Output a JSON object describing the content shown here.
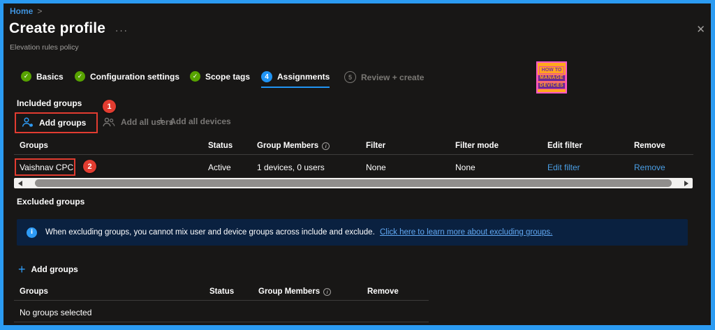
{
  "breadcrumb": {
    "home": "Home",
    "separator": ">"
  },
  "header": {
    "title": "Create profile",
    "ellipsis": "···",
    "subtitle": "Elevation rules policy",
    "close": "✕"
  },
  "tabs": {
    "check": "✓",
    "basics": "Basics",
    "configuration": "Configuration settings",
    "scope": "Scope tags",
    "assignments": "Assignments",
    "assignments_step": "4",
    "review": "Review + create",
    "review_step": "5"
  },
  "logo": {
    "line1": "HOW TO",
    "line2": "MANAGE",
    "line3": "DEVICES"
  },
  "included": {
    "heading": "Included groups",
    "annotation1": "1",
    "annotation2": "2",
    "add_groups": "Add groups",
    "add_all_users": "Add all users",
    "add_all_devices": "Add all devices",
    "plus": "+",
    "info_icon": "i",
    "headers": [
      "Groups",
      "Status",
      "Group Members",
      "Filter",
      "Filter mode",
      "Edit filter",
      "Remove"
    ],
    "row": {
      "group": "Vaishnav CPC",
      "status": "Active",
      "members": "1 devices, 0 users",
      "filter": "None",
      "filter_mode": "None",
      "edit_filter": "Edit filter",
      "remove": "Remove"
    }
  },
  "excluded": {
    "heading": "Excluded groups",
    "banner_icon": "i",
    "banner_text": "When excluding groups, you cannot mix user and device groups across include and exclude.",
    "banner_link": "Click here to learn more about excluding groups.",
    "plus": "+",
    "add_groups": "Add groups",
    "info_icon": "i",
    "headers": [
      "Groups",
      "Status",
      "Group Members",
      "Remove"
    ],
    "empty": "No groups selected"
  },
  "colors": {
    "accent_border": "#2b9bf2",
    "annotation_red": "#e23c30",
    "link_blue": "#4a9fe6",
    "active_tab_blue": "#2094f3",
    "complete_green": "#57a300",
    "banner_bg": "#0a2140"
  }
}
